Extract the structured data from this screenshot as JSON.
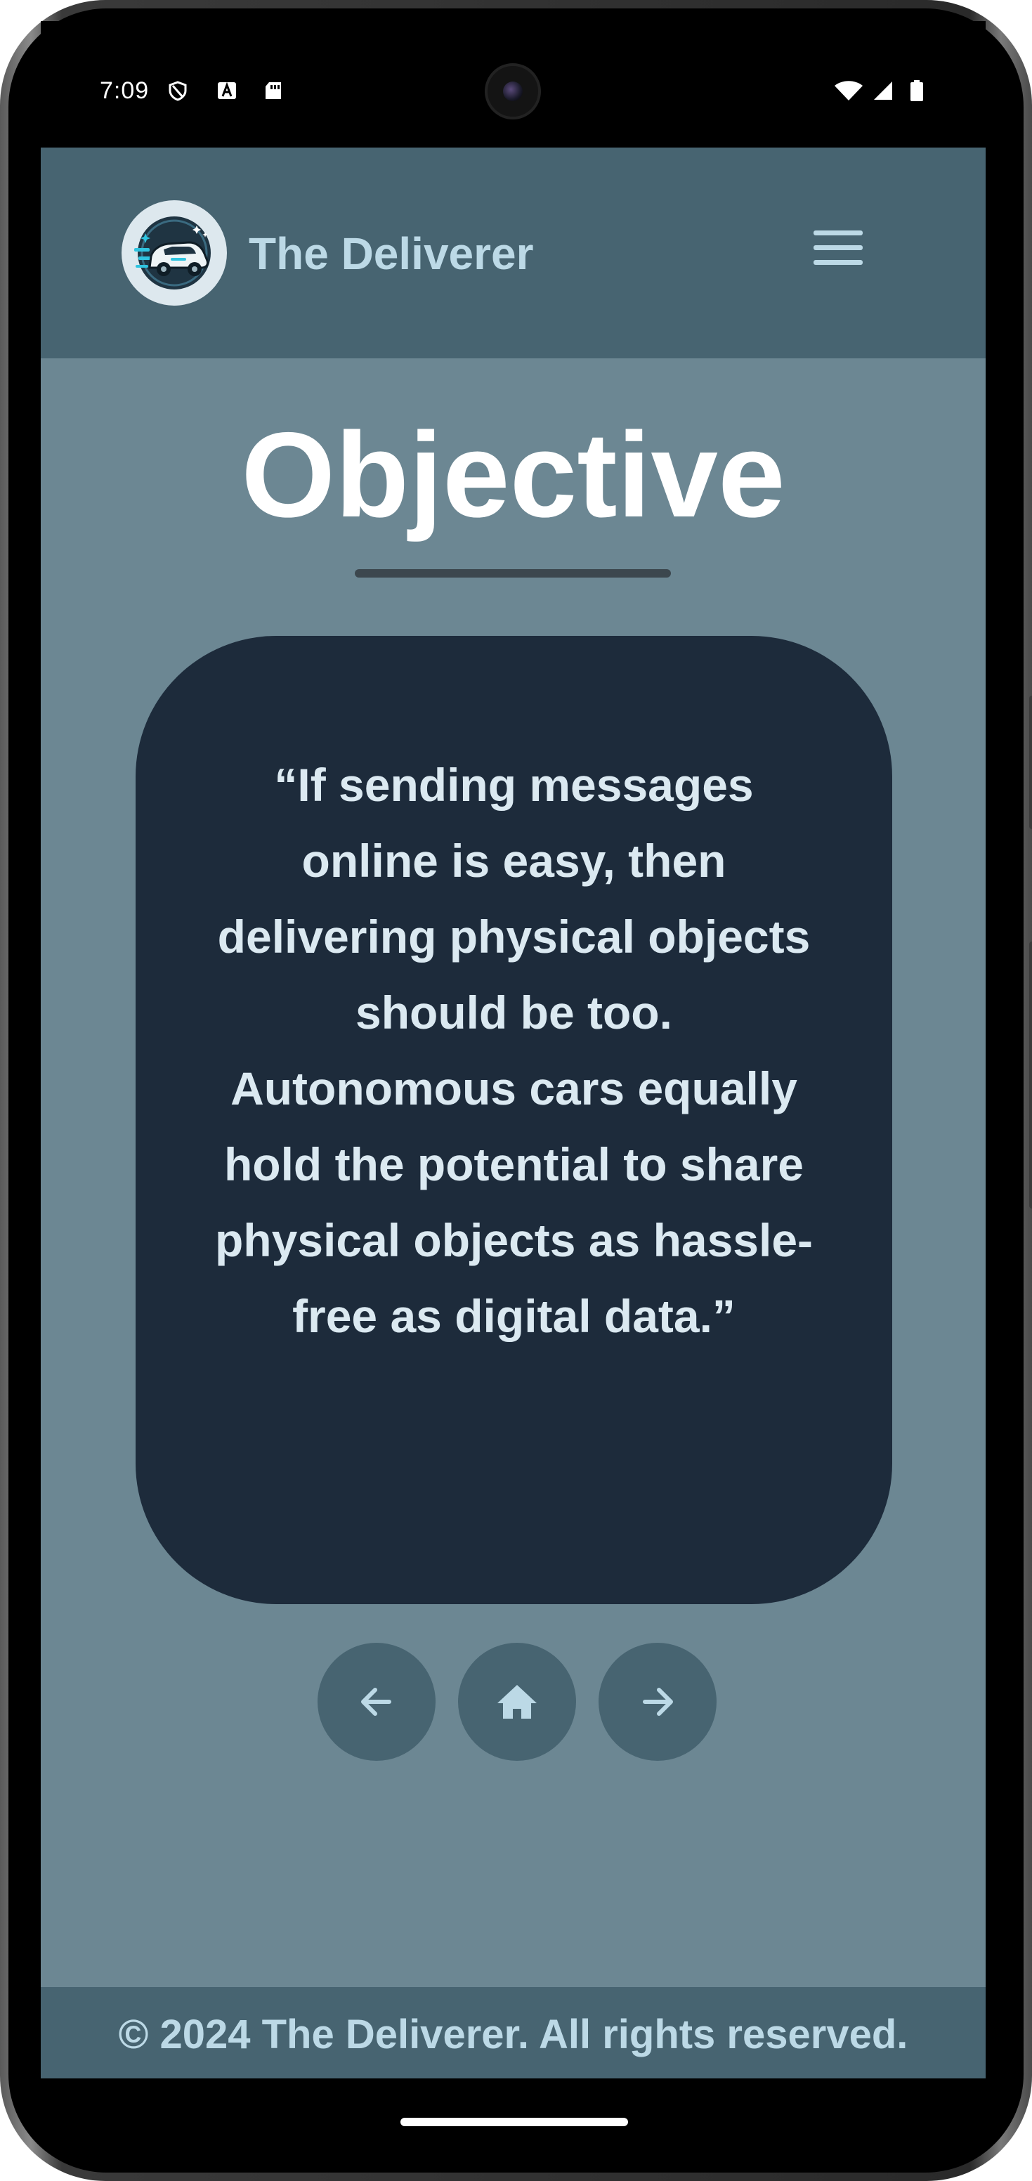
{
  "status_bar": {
    "time": "7:09",
    "left_icons": [
      "vpn-shield-icon",
      "a-badge-icon",
      "sd-card-icon"
    ],
    "right_icons": [
      "wifi-icon",
      "cell-signal-icon",
      "battery-icon"
    ]
  },
  "header": {
    "brand": "The Deliverer",
    "logo_icon": "delivery-car-icon",
    "menu_icon": "hamburger-menu-icon"
  },
  "main": {
    "title": "Objective",
    "quote": "“If sending messages online is easy, then delivering physical objects should be too. Autonomous cars equally hold the potential to share physical objects as hassle-free as digital data.”",
    "nav": {
      "prev_icon": "arrow-left-icon",
      "home_icon": "home-icon",
      "next_icon": "arrow-right-icon"
    }
  },
  "footer": {
    "text": "© 2024 The Deliverer. All rights reserved."
  },
  "colors": {
    "header_bg": "#476471",
    "main_bg": "#6c8793",
    "card_bg": "#1d2b3b",
    "accent_text": "#bcd9e6",
    "title_text": "#ffffff"
  }
}
